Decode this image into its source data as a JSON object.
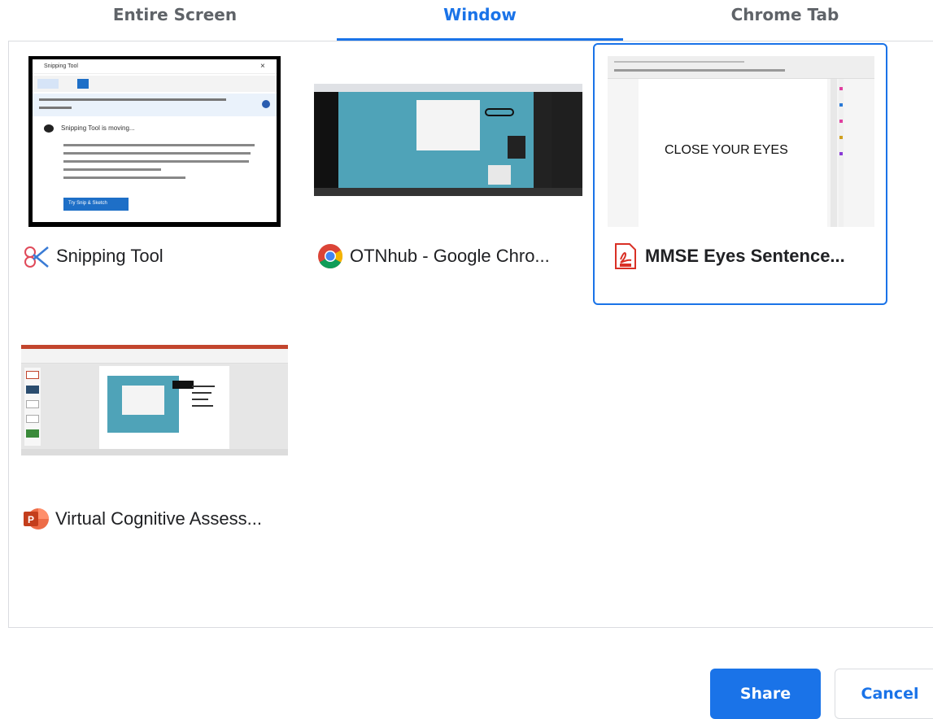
{
  "tabs": [
    {
      "label": "Entire Screen",
      "active": false
    },
    {
      "label": "Window",
      "active": true
    },
    {
      "label": "Chrome Tab",
      "active": false
    }
  ],
  "sources": [
    {
      "label": "Snipping Tool",
      "icon": "snipping-tool-icon",
      "selected": false,
      "thumb_text": {
        "title": "Snipping Tool",
        "moving": "Snipping Tool is moving...",
        "button": "Try Snip & Sketch"
      }
    },
    {
      "label": "OTNhub - Google Chro...",
      "icon": "chrome-icon",
      "selected": false
    },
    {
      "label": "MMSE Eyes Sentence...",
      "icon": "pdf-icon",
      "selected": true,
      "thumb_text": {
        "doc": "CLOSE YOUR EYES"
      }
    },
    {
      "label": "Virtual Cognitive Assess...",
      "icon": "powerpoint-icon",
      "selected": false
    }
  ],
  "buttons": {
    "share": "Share",
    "cancel": "Cancel"
  },
  "colors": {
    "accent": "#1a73e8",
    "border": "#dadce0"
  }
}
